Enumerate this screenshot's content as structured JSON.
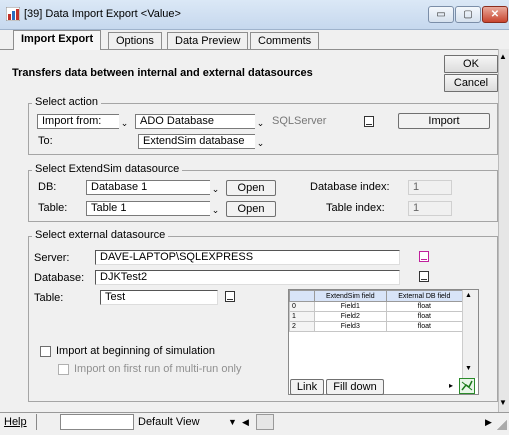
{
  "window": {
    "title": "[39]  Data Import Export  <Value>",
    "controls": {
      "minimize": "▭",
      "maximize": "▢",
      "close": "✕"
    }
  },
  "tabs": [
    {
      "label": "Import Export",
      "active": true
    },
    {
      "label": "Options",
      "active": false
    },
    {
      "label": "Data Preview",
      "active": false
    },
    {
      "label": "Comments",
      "active": false
    }
  ],
  "header": {
    "description": "Transfers data between internal and external datasources",
    "ok_label": "OK",
    "cancel_label": "Cancel"
  },
  "select_action": {
    "legend": "Select action",
    "mode_value": "Import from:",
    "source_value": "ADO Database",
    "provider_value": "SQLServer",
    "to_label": "To:",
    "destination_value": "ExtendSim database",
    "import_button": "Import"
  },
  "extendsim_ds": {
    "legend": "Select ExtendSim datasource",
    "db_label": "DB:",
    "db_value": "Database 1",
    "db_open": "Open",
    "db_index_label": "Database index:",
    "db_index_value": "1",
    "table_label": "Table:",
    "table_value": "Table 1",
    "table_open": "Open",
    "table_index_label": "Table index:",
    "table_index_value": "1"
  },
  "external_ds": {
    "legend": "Select external datasource",
    "server_label": "Server:",
    "server_value": "DAVE-LAPTOP\\SQLEXPRESS",
    "database_label": "Database:",
    "database_value": "DJKTest2",
    "table_label": "Table:",
    "table_value": "Test",
    "import_at_beginning": "Import at beginning of simulation",
    "import_on_first_run": "Import on first run of multi-run only",
    "link_button": "Link",
    "fill_down_button": "Fill down",
    "mapping_table": {
      "headers": [
        "",
        "ExtendSim field",
        "External DB field"
      ],
      "rows": [
        [
          "0",
          "Field1",
          "float"
        ],
        [
          "1",
          "Field2",
          "float"
        ],
        [
          "2",
          "Field3",
          "float"
        ]
      ]
    }
  },
  "footer": {
    "help_label": "Help",
    "view_value": "Default View"
  },
  "colors": {
    "accent_pink": "#c0209c",
    "header_blue": "#d8e4f8",
    "close_red": "#c8452f"
  }
}
